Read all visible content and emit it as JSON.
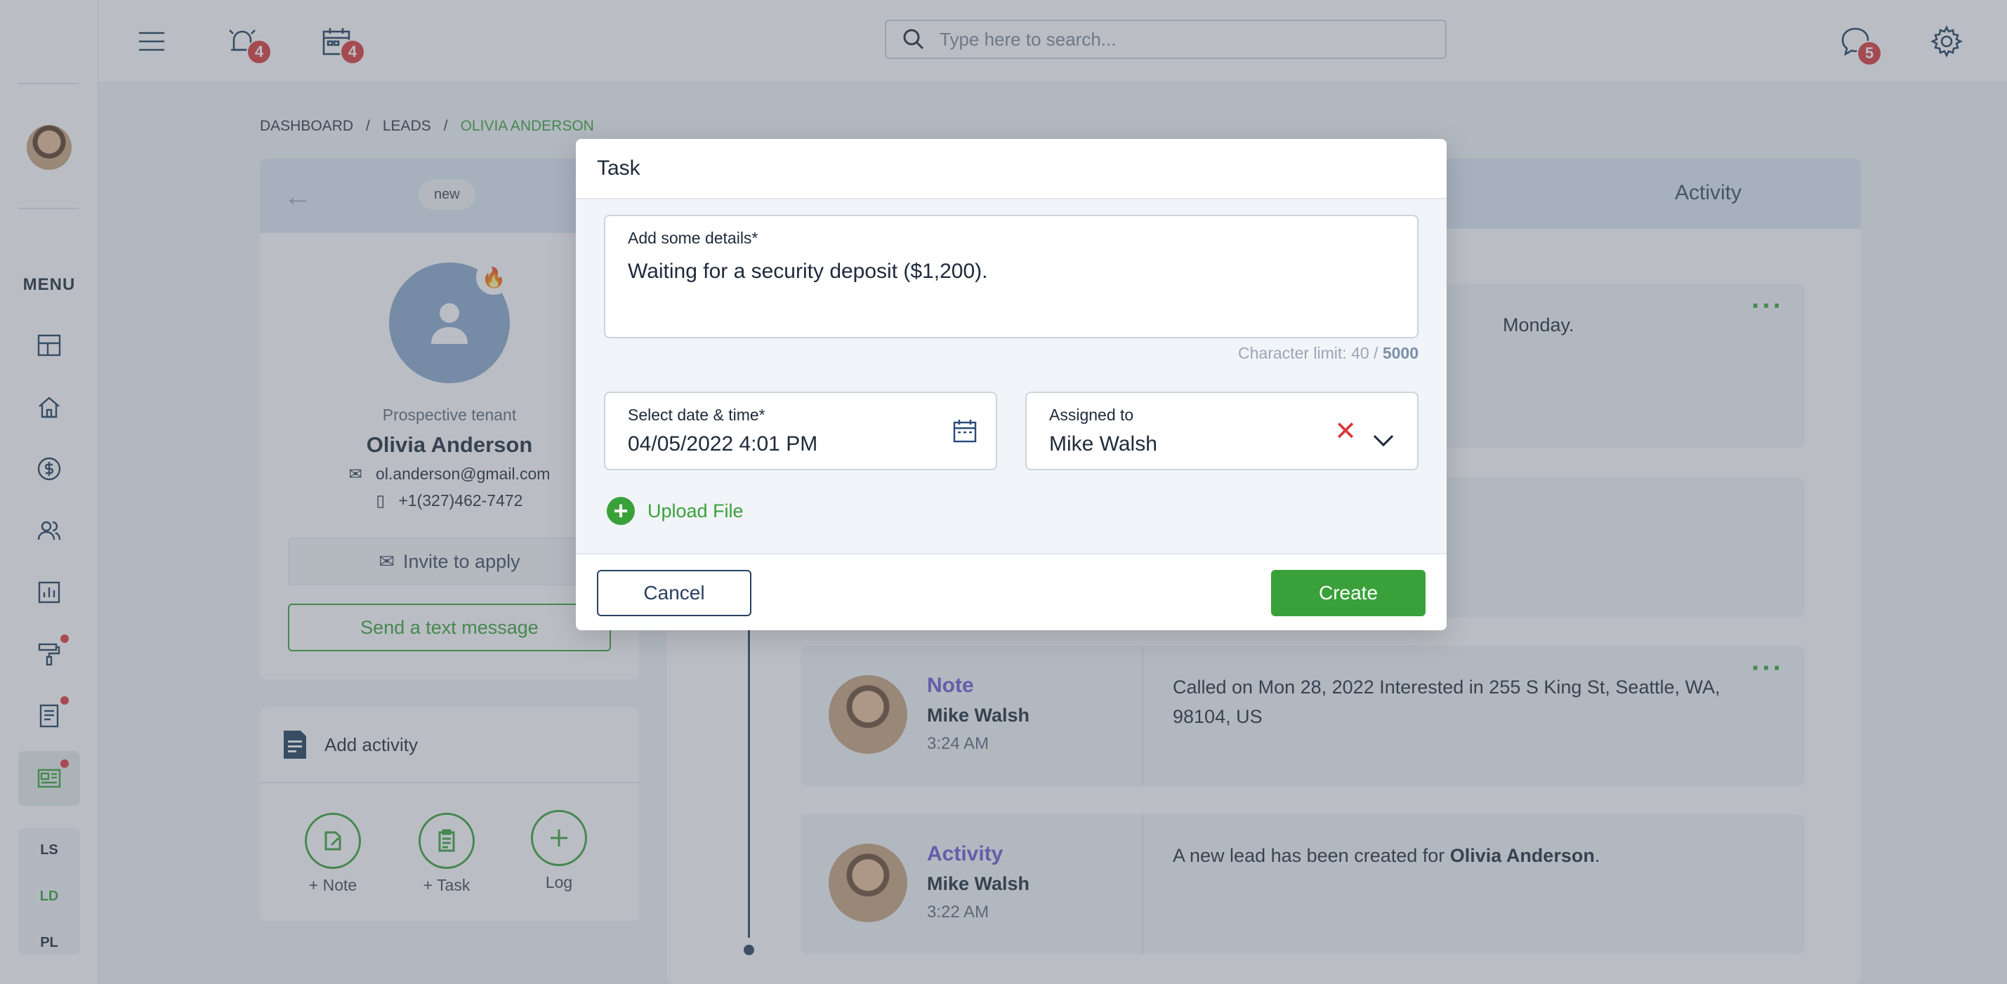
{
  "topbar": {
    "alerts_badge": "4",
    "calendar_badge": "4",
    "messages_badge": "5",
    "search_placeholder": "Type here to search..."
  },
  "sidebar": {
    "menu_label": "MENU",
    "codes": [
      "LS",
      "LD",
      "PL"
    ]
  },
  "breadcrumb": {
    "items": [
      "DASHBOARD",
      "LEADS",
      "OLIVIA ANDERSON"
    ],
    "separator": "/"
  },
  "profile": {
    "status": "new",
    "role": "Prospective tenant",
    "name": "Olivia Anderson",
    "email": "ol.anderson@gmail.com",
    "phone": "+1(327)462-7472",
    "invite_label": "Invite to apply",
    "sms_label": "Send a text message"
  },
  "add_activity": {
    "title": "Add activity",
    "actions": [
      "+ Note",
      "+ Task",
      "Log"
    ]
  },
  "right_panel": {
    "tab": "Activity",
    "items": [
      {
        "type": "",
        "author": "",
        "time": "",
        "desc": "Monday."
      },
      {
        "type": "Note",
        "author": "Mike Walsh",
        "time": "3:24 AM",
        "desc": "Called on Mon 28, 2022 Interested in 255 S King St, Seattle, WA, 98104, US"
      },
      {
        "type": "Activity",
        "author": "Mike Walsh",
        "time": "3:22 AM",
        "desc_prefix": "A new lead has been created for ",
        "desc_bold": "Olivia Anderson",
        "desc_suffix": "."
      }
    ]
  },
  "modal": {
    "title": "Task",
    "details_label": "Add some details*",
    "details_value": "Waiting for a security deposit ($1,200).",
    "char_limit_prefix": "Character limit: 40 / ",
    "char_limit_max": "5000",
    "date_label": "Select date & time*",
    "date_value": "04/05/2022 4:01 PM",
    "assigned_label": "Assigned to",
    "assigned_value": "Mike Walsh",
    "upload_label": "Upload File",
    "cancel_label": "Cancel",
    "create_label": "Create"
  },
  "colors": {
    "accent_green": "#3aa13a",
    "badge_red": "#d93a3a",
    "navy": "#1f3b5a",
    "note_purple": "#6a5ad0"
  }
}
